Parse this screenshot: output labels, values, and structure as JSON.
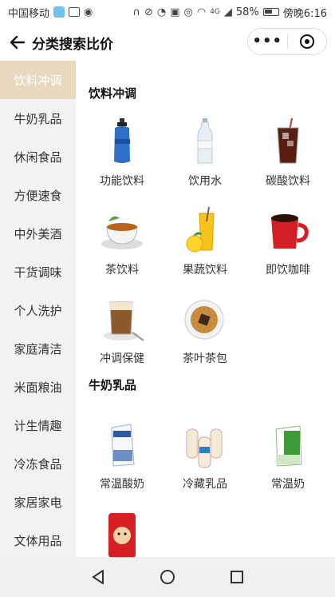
{
  "status_bar": {
    "carrier": "中国移动",
    "battery_percent": "58%",
    "time": "傍晚6:16",
    "network": "4G"
  },
  "header": {
    "title": "分类搜索比价",
    "back_icon": "arrow-left-icon",
    "more_icon": "more-dots-icon",
    "target_icon": "target-icon"
  },
  "sidebar": {
    "items": [
      {
        "label": "饮料冲调",
        "active": true
      },
      {
        "label": "牛奶乳品"
      },
      {
        "label": "休闲食品"
      },
      {
        "label": "方便速食"
      },
      {
        "label": "中外美酒"
      },
      {
        "label": "干货调味"
      },
      {
        "label": "个人洗护"
      },
      {
        "label": "家庭清洁"
      },
      {
        "label": "米面粮油"
      },
      {
        "label": "计生情趣"
      },
      {
        "label": "冷冻食品"
      },
      {
        "label": "家居家电"
      },
      {
        "label": "文体用品"
      }
    ]
  },
  "sections": [
    {
      "title": "饮料冲调",
      "items": [
        {
          "label": "功能饮料",
          "icon": "sports-bottle-icon"
        },
        {
          "label": "饮用水",
          "icon": "water-bottle-icon"
        },
        {
          "label": "碳酸饮料",
          "icon": "cola-glass-icon"
        },
        {
          "label": "茶饮料",
          "icon": "tea-cup-icon"
        },
        {
          "label": "果蔬饮料",
          "icon": "juice-glass-icon"
        },
        {
          "label": "即饮咖啡",
          "icon": "coffee-mug-icon"
        },
        {
          "label": "冲调保健",
          "icon": "latte-glass-icon"
        },
        {
          "label": "茶叶茶包",
          "icon": "tea-bag-cup-icon"
        }
      ]
    },
    {
      "title": "牛奶乳品",
      "items": [
        {
          "label": "常温酸奶",
          "icon": "yogurt-carton-icon"
        },
        {
          "label": "冷藏乳品",
          "icon": "yakult-bottles-icon"
        },
        {
          "label": "常温奶",
          "icon": "milk-carton-icon"
        },
        {
          "label": "",
          "icon": "milk-can-icon"
        }
      ]
    }
  ],
  "colors": {
    "sidebar_active": "#e8d8bf",
    "sidebar_bg": "#f2f2f2",
    "nav_bg": "#f0f0f0"
  }
}
